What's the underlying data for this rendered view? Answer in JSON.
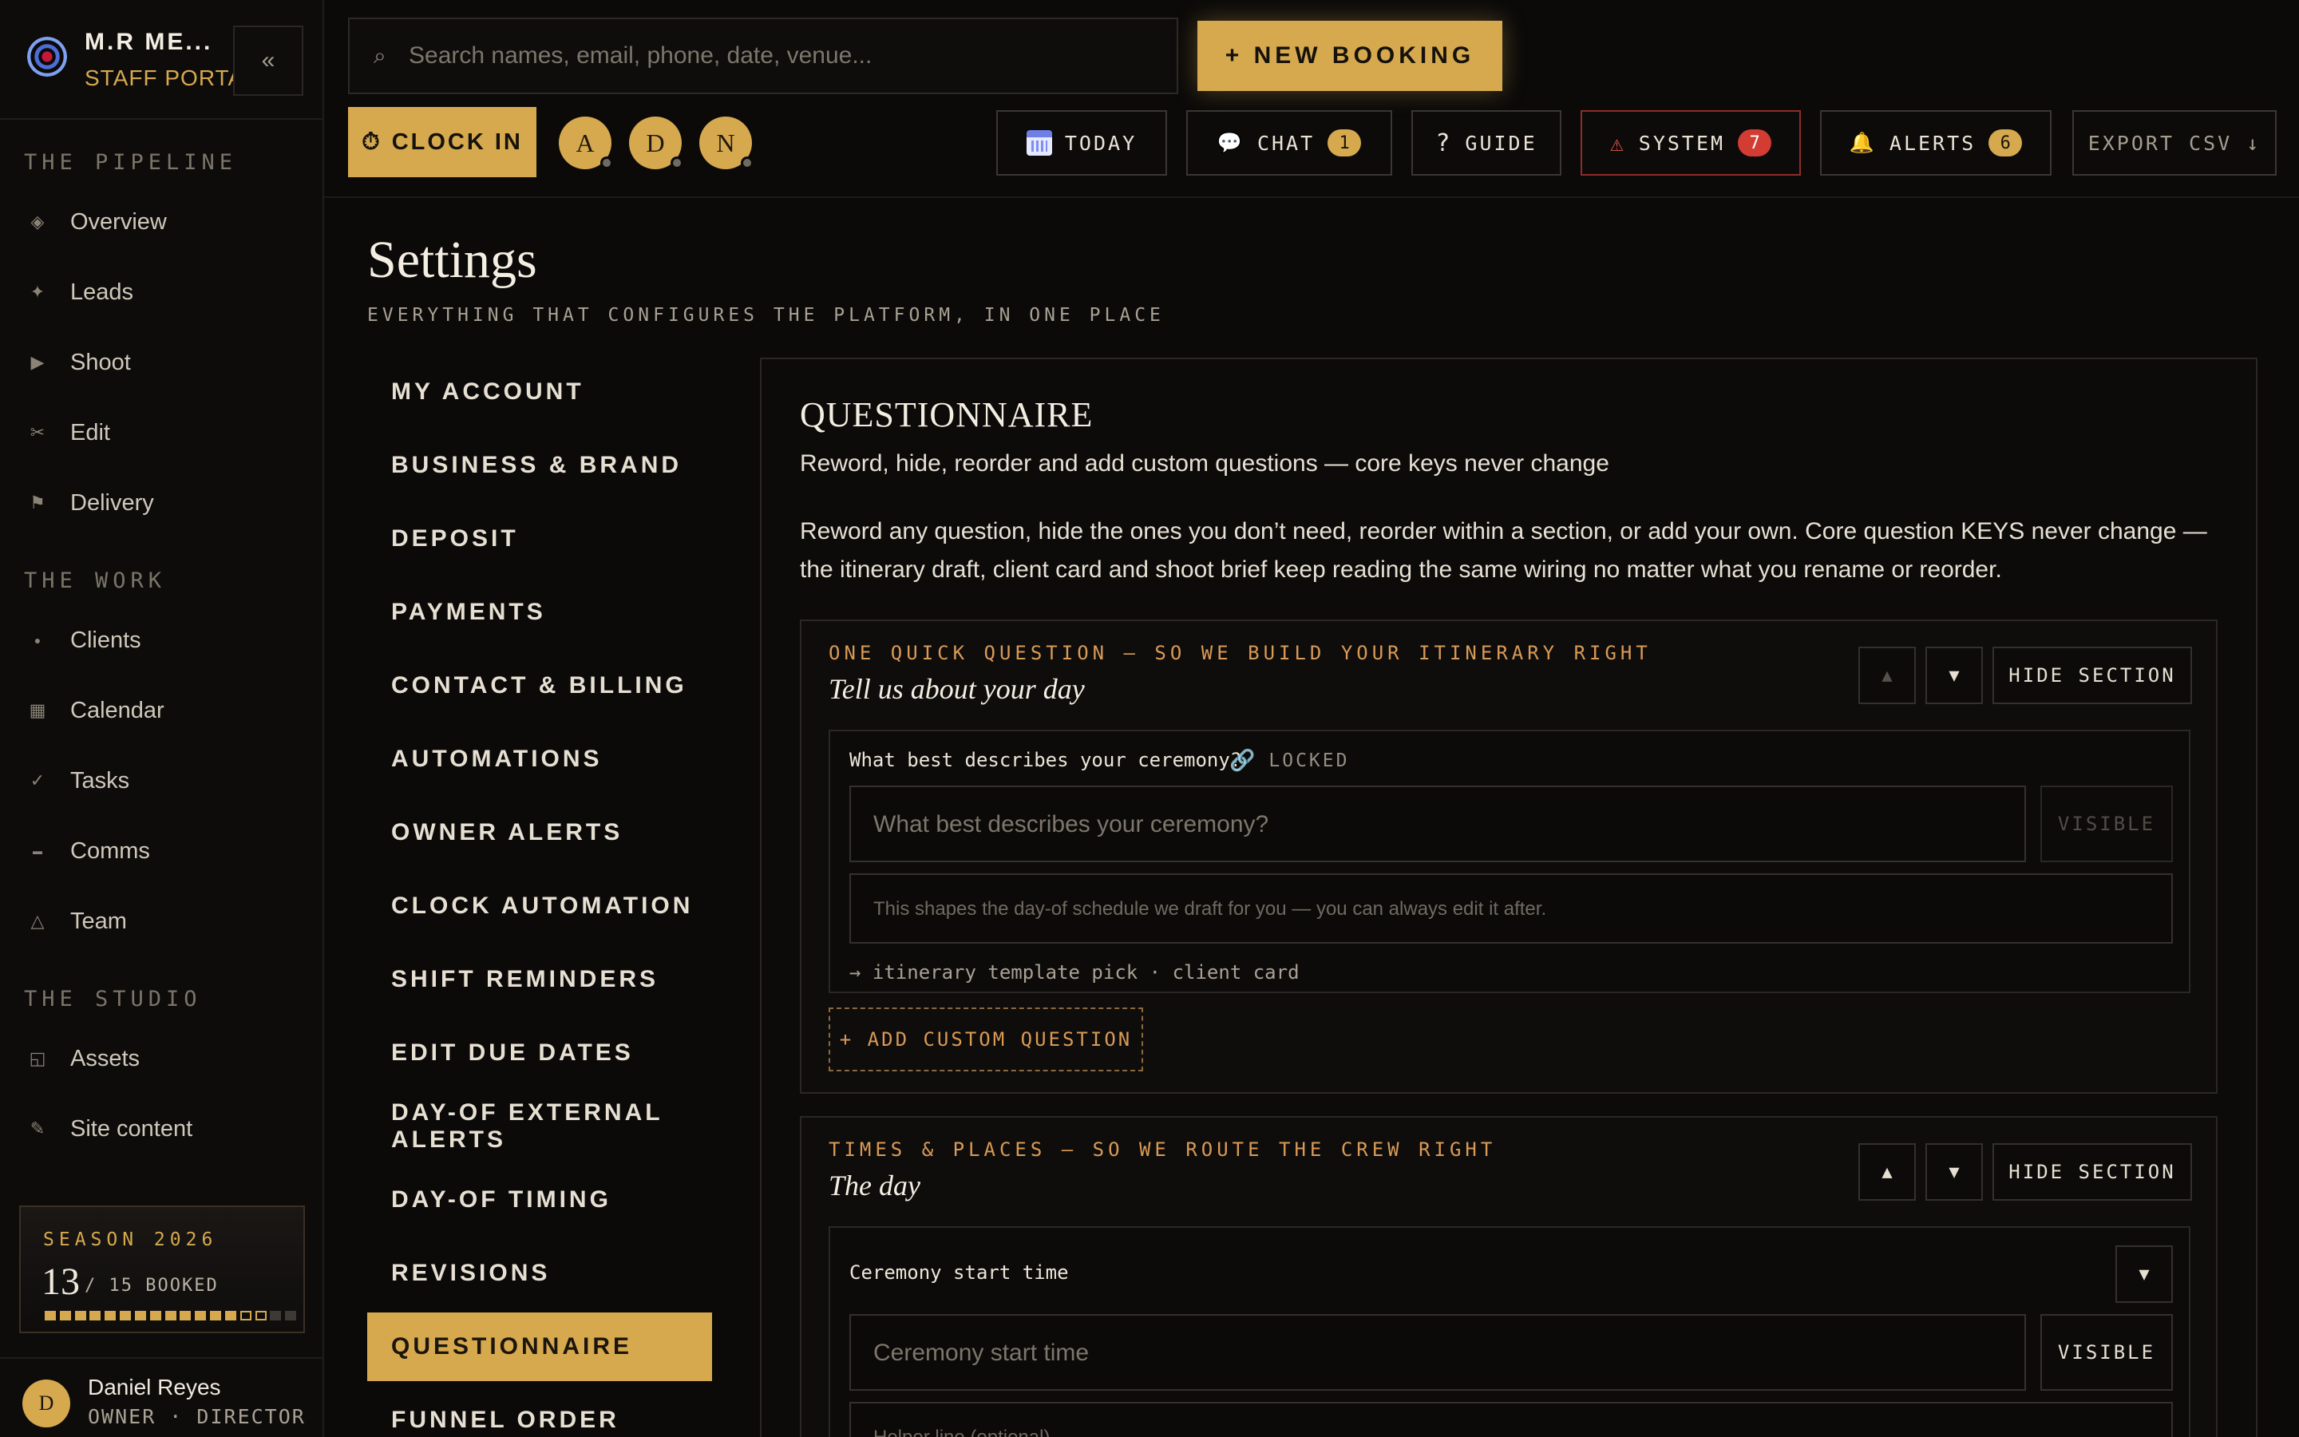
{
  "brand": {
    "name": "M.R ME...",
    "subtitle": "STAFF PORTAL",
    "collapse_label": "«"
  },
  "sidebar": {
    "groups": [
      {
        "label": "THE PIPELINE"
      },
      {
        "label": "THE WORK"
      },
      {
        "label": "THE STUDIO"
      }
    ],
    "items": [
      {
        "label": "Overview",
        "icon": "◈"
      },
      {
        "label": "Leads",
        "icon": "✦"
      },
      {
        "label": "Shoot",
        "icon": "▶"
      },
      {
        "label": "Edit",
        "icon": "✂"
      },
      {
        "label": "Delivery",
        "icon": "⚑"
      },
      {
        "label": "Clients",
        "icon": "●"
      },
      {
        "label": "Calendar",
        "icon": "▦"
      },
      {
        "label": "Tasks",
        "icon": "✓"
      },
      {
        "label": "Comms",
        "icon": "▬"
      },
      {
        "label": "Team",
        "icon": "△"
      },
      {
        "label": "Assets",
        "icon": "◱"
      },
      {
        "label": "Site content",
        "icon": "✎"
      }
    ],
    "season": {
      "label": "SEASON 2026",
      "booked": 13,
      "total_label": "/ 15 BOOKED",
      "total": 15
    },
    "user": {
      "initial": "D",
      "name": "Daniel Reyes",
      "role": "OWNER · DIRECTOR"
    }
  },
  "topbar": {
    "search_placeholder": "Search names, email, phone, date, venue...",
    "search_icon": "⌕",
    "new_booking": "+ NEW BOOKING",
    "clock_in": "CLOCK IN",
    "clock_icon": "⏱",
    "staff": [
      "A",
      "D",
      "N"
    ],
    "buttons": {
      "today": "TODAY",
      "chat": "CHAT",
      "chat_count": "1",
      "chat_icon": "💬",
      "guide": "GUIDE",
      "guide_icon": "?",
      "system": "SYSTEM",
      "system_count": "7",
      "system_icon": "⚠",
      "alerts": "ALERTS",
      "alerts_count": "6",
      "alerts_icon": "🔔",
      "export": "EXPORT CSV ↓"
    }
  },
  "page": {
    "title": "Settings",
    "subtitle": "EVERYTHING THAT CONFIGURES THE PLATFORM, IN ONE PLACE"
  },
  "settings_nav": [
    "MY ACCOUNT",
    "BUSINESS & BRAND",
    "DEPOSIT",
    "PAYMENTS",
    "CONTACT & BILLING",
    "AUTOMATIONS",
    "OWNER ALERTS",
    "CLOCK AUTOMATION",
    "SHIFT REMINDERS",
    "EDIT DUE DATES",
    "DAY-OF EXTERNAL ALERTS",
    "DAY-OF TIMING",
    "REVISIONS",
    "QUESTIONNAIRE",
    "FUNNEL ORDER"
  ],
  "questionnaire": {
    "title": "QUESTIONNAIRE",
    "subtitle": "Reword, hide, reorder and add custom questions — core keys never change",
    "description": "Reword any question, hide the ones you don’t need, reorder within a section, or add your own. Core question KEYS never change — the itinerary draft, client card and shoot brief keep reading the same wiring no matter what you rename or reorder.",
    "hide_section": "HIDE SECTION",
    "up": "▲",
    "down": "▼",
    "sections": [
      {
        "kicker": "ONE QUICK QUESTION — SO WE BUILD YOUR ITINERARY RIGHT",
        "name": "Tell us about your day",
        "question": {
          "key": "What best describes your ceremony?",
          "locked": "LOCKED",
          "placeholder": "What best describes your ceremony?",
          "visible": "VISIBLE",
          "helper": "This shapes the day-of schedule we draft for you — you can always edit it after.",
          "wiring": "→ itinerary template pick · client card"
        },
        "add_custom": "+ ADD CUSTOM QUESTION"
      },
      {
        "kicker": "TIMES & PLACES — SO WE ROUTE THE CREW RIGHT",
        "name": "The day",
        "question": {
          "key": "Ceremony start time",
          "placeholder": "Ceremony start time",
          "visible": "VISIBLE",
          "helper_placeholder": "Helper line (optional)"
        }
      }
    ]
  }
}
